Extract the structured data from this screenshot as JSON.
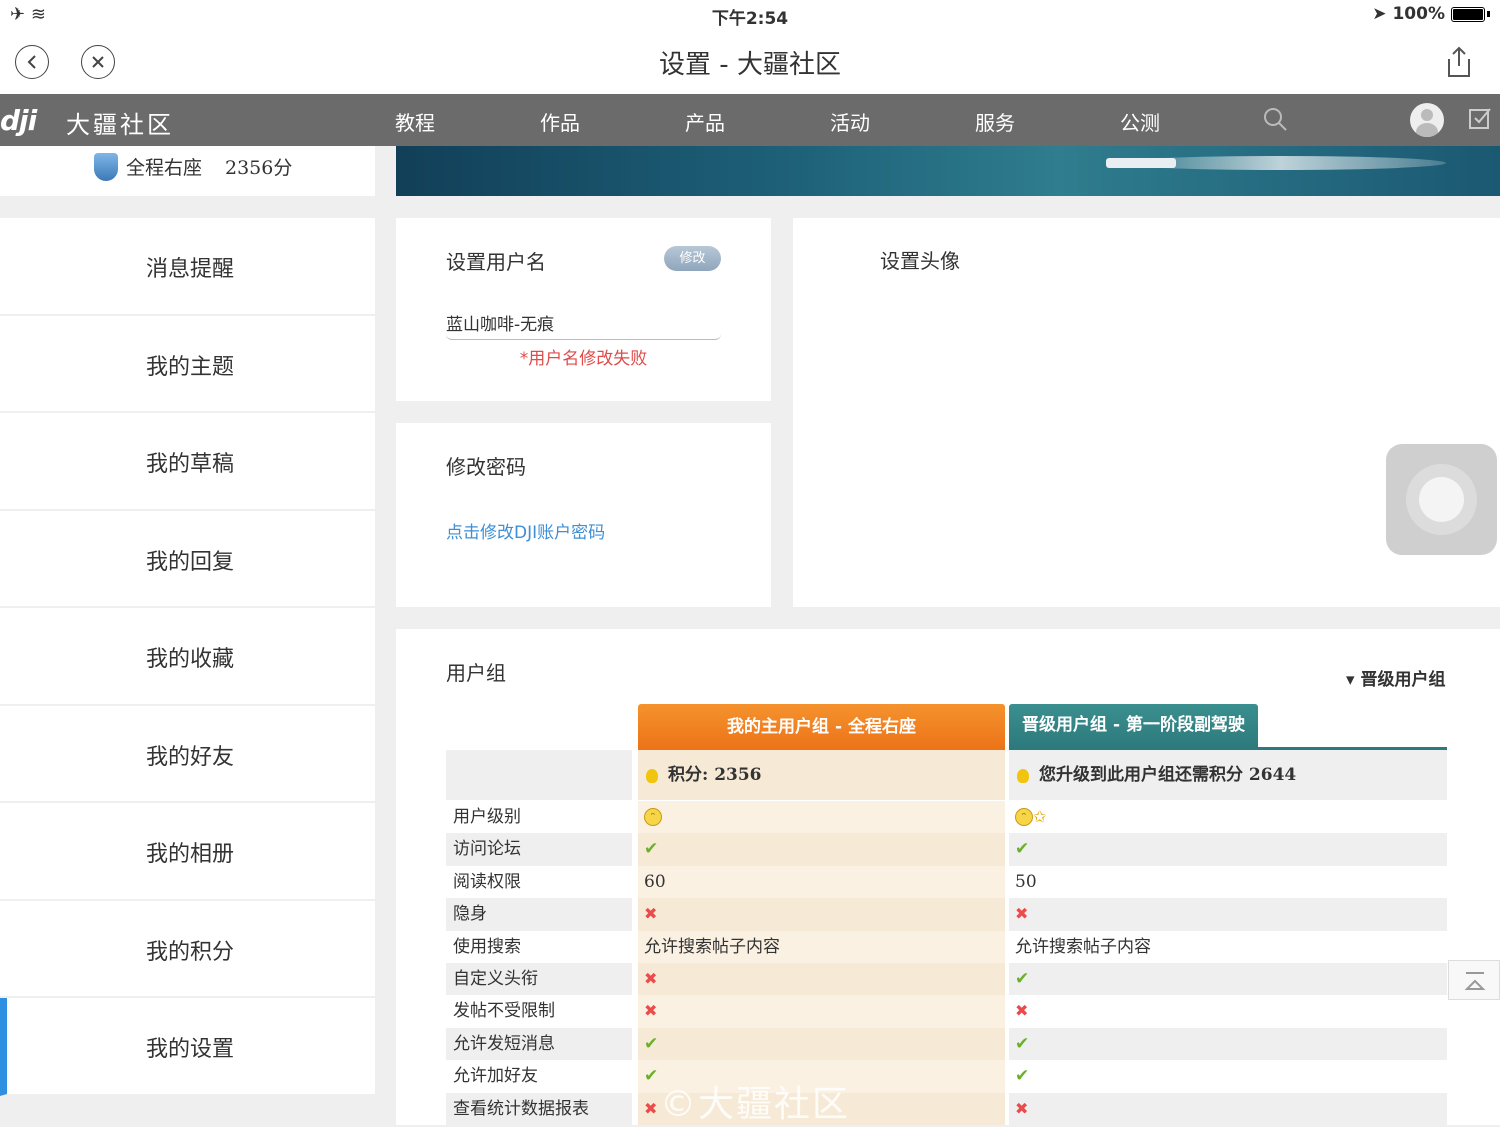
{
  "status_bar": {
    "time": "下午2:54",
    "battery": "100%"
  },
  "nav": {
    "title": "设置 - 大疆社区"
  },
  "site_header": {
    "brand": "大疆社区",
    "menu": [
      "教程",
      "作品",
      "产品",
      "活动",
      "服务",
      "公测"
    ]
  },
  "profile": {
    "group": "全程右座",
    "score": "2356分"
  },
  "sidebar": {
    "items": [
      "消息提醒",
      "我的主题",
      "我的草稿",
      "我的回复",
      "我的收藏",
      "我的好友",
      "我的相册",
      "我的积分",
      "我的设置"
    ],
    "active": "我的设置"
  },
  "username_card": {
    "title": "设置用户名",
    "edit_label": "修改",
    "value": "蓝山咖啡-无痕",
    "error": "*用户名修改失败"
  },
  "password_card": {
    "title": "修改密码",
    "link": "点击修改DJI账户密码"
  },
  "avatar_card": {
    "title": "设置头像"
  },
  "group_card": {
    "title": "用户组",
    "upgrade_toggle": "▾ 晋级用户组",
    "tab_main": "我的主用户组 - 全程右座",
    "tab_upgrade": "晋级用户组 - 第一阶段副驾驶",
    "score_main": "积分: 2356",
    "score_upgrade": "您升级到此用户组还需积分 2644",
    "rows": [
      {
        "label": "用户级别",
        "main": "",
        "upgrade": ""
      },
      {
        "label": "访问论坛",
        "main": "✔",
        "upgrade": "✔"
      },
      {
        "label": "阅读权限",
        "main": "60",
        "upgrade": "50"
      },
      {
        "label": "隐身",
        "main": "✖",
        "upgrade": "✖"
      },
      {
        "label": "使用搜索",
        "main": "允许搜索帖子内容",
        "upgrade": "允许搜索帖子内容"
      },
      {
        "label": "自定义头衔",
        "main": "✖",
        "upgrade": "✔"
      },
      {
        "label": "发帖不受限制",
        "main": "✖",
        "upgrade": "✖"
      },
      {
        "label": "允许发短消息",
        "main": "✔",
        "upgrade": "✔"
      },
      {
        "label": "允许加好友",
        "main": "✔",
        "upgrade": "✔"
      },
      {
        "label": "查看统计数据报表",
        "main": "✖",
        "upgrade": "✖"
      }
    ]
  },
  "watermark": "©大疆社区",
  "colors": {
    "accent_orange": "#ec7317",
    "accent_teal": "#2d7a7d",
    "active_blue": "#2f8fe0",
    "error_red": "#e04a4a",
    "link_blue": "#3d8fd6",
    "check_green": "#6bb02a",
    "cross_red": "#ea4b4b"
  }
}
